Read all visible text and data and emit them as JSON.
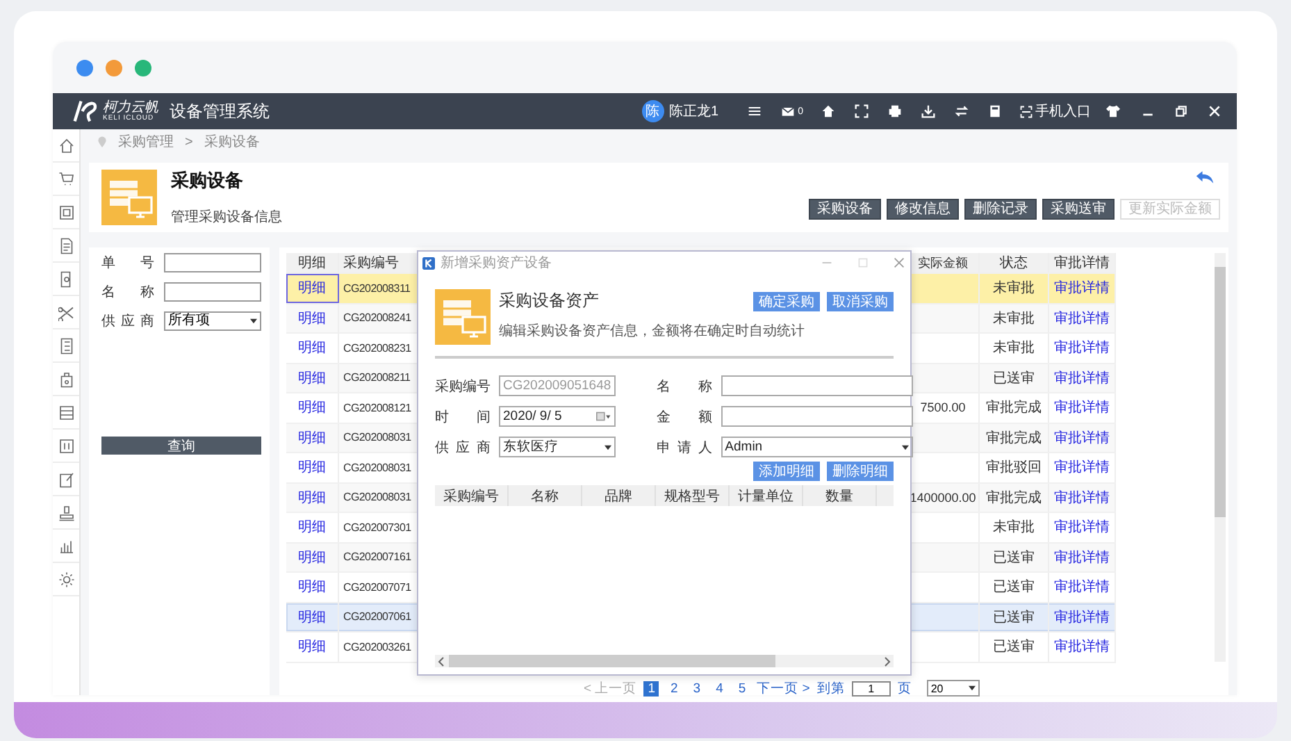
{
  "app": {
    "logo_name": "柯力云帆",
    "logo_sub": "KELI ICLOUD",
    "title": "设备管理系统"
  },
  "user": {
    "avatar": "陈",
    "name": "陈正龙1"
  },
  "toolbar": {
    "mail_count": "0",
    "mobile_entry": "手机入口"
  },
  "breadcrumb": {
    "items": [
      "采购管理",
      "采购设备"
    ],
    "separator": ">"
  },
  "page_header": {
    "title": "采购设备",
    "subtitle": "管理采购设备信息",
    "buttons": [
      {
        "label": "采购设备",
        "disabled": false
      },
      {
        "label": "修改信息",
        "disabled": false
      },
      {
        "label": "删除记录",
        "disabled": false
      },
      {
        "label": "采购送审",
        "disabled": false
      },
      {
        "label": "更新实际金额",
        "disabled": true
      }
    ]
  },
  "filters": [
    {
      "label": "单 号",
      "kind": "input"
    },
    {
      "label": "名 称",
      "kind": "input"
    },
    {
      "label": "供 应 商",
      "kind": "select",
      "value": "所有项"
    }
  ],
  "query_button": "查询",
  "table": {
    "columns": [
      "明细",
      "采购编号",
      "实际金额",
      "状态",
      "审批详情"
    ],
    "rows": [
      {
        "detail": "明细",
        "code": "CG202008311",
        "status": "未审批",
        "approval": "审批详情",
        "selected": true,
        "hovered": false
      },
      {
        "detail": "明细",
        "code": "CG202008241",
        "status": "未审批",
        "approval": "审批详情",
        "selected": false,
        "hovered": false
      },
      {
        "detail": "明细",
        "code": "CG202008231",
        "status": "未审批",
        "approval": "审批详情",
        "selected": false,
        "hovered": false
      },
      {
        "detail": "明细",
        "code": "CG202008211",
        "status": "已送审",
        "approval": "审批详情",
        "selected": false,
        "hovered": false
      },
      {
        "detail": "明细",
        "code": "CG202008121",
        "amount": "7500.00",
        "status": "审批完成",
        "approval": "审批详情",
        "selected": false,
        "hovered": false
      },
      {
        "detail": "明细",
        "code": "CG202008031",
        "status": "审批完成",
        "approval": "审批详情",
        "selected": false,
        "hovered": false
      },
      {
        "detail": "明细",
        "code": "CG202008031",
        "status": "审批驳回",
        "approval": "审批详情",
        "selected": false,
        "hovered": false
      },
      {
        "detail": "明细",
        "code": "CG202008031",
        "amount": "1400000.00",
        "status": "审批完成",
        "approval": "审批详情",
        "selected": false,
        "hovered": false
      },
      {
        "detail": "明细",
        "code": "CG202007301",
        "status": "未审批",
        "approval": "审批详情",
        "selected": false,
        "hovered": false
      },
      {
        "detail": "明细",
        "code": "CG202007161",
        "status": "已送审",
        "approval": "审批详情",
        "selected": false,
        "hovered": false
      },
      {
        "detail": "明细",
        "code": "CG202007071",
        "status": "已送审",
        "approval": "审批详情",
        "selected": false,
        "hovered": false
      },
      {
        "detail": "明细",
        "code": "CG202007061",
        "status": "已送审",
        "approval": "审批详情",
        "selected": false,
        "hovered": true
      },
      {
        "detail": "明细",
        "code": "CG202003261",
        "status": "已送审",
        "approval": "审批详情",
        "selected": false,
        "hovered": false
      }
    ]
  },
  "pagination": {
    "prev": "< 上一页",
    "pages": [
      {
        "label": "1",
        "selected": true
      },
      {
        "label": "2",
        "selected": false
      },
      {
        "label": "3",
        "selected": false
      },
      {
        "label": "4",
        "selected": false
      },
      {
        "label": "5",
        "selected": false
      }
    ],
    "next": "下一页 >",
    "goto_label": "到第",
    "goto_value": "1",
    "goto_unit": "页",
    "page_size": "20"
  },
  "dialog": {
    "title": "新增采购资产设备",
    "heading": "采购设备资产",
    "subtitle": "编辑采购设备资产信息，金额将在确定时自动统计",
    "actions": [
      "确定采购",
      "取消采购"
    ],
    "fields": [
      {
        "label": "采购编号",
        "kind": "input",
        "value": "CG202009051648",
        "disabled": true
      },
      {
        "label": "名 称",
        "kind": "input",
        "disabled": false
      },
      {
        "label": "时 间",
        "kind": "date",
        "value": "2020/ 9/ 5",
        "disabled": false
      },
      {
        "label": "金 额",
        "kind": "input",
        "disabled": false
      },
      {
        "label": "供 应 商",
        "kind": "select",
        "value": "东软医疗",
        "disabled": false
      },
      {
        "label": "申 请 人",
        "kind": "select",
        "value": "Admin",
        "disabled": false
      }
    ],
    "detail_buttons": [
      "添加明细",
      "删除明细"
    ],
    "grid_columns": [
      "采购编号",
      "名称",
      "品牌",
      "规格型号",
      "计量单位",
      "数量"
    ]
  }
}
